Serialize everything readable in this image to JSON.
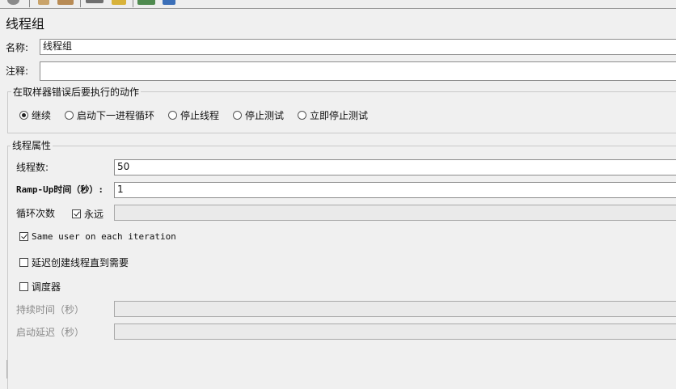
{
  "panel_title": "线程组",
  "name": {
    "label": "名称:",
    "value": "线程组"
  },
  "comment": {
    "label": "注释:",
    "value": ""
  },
  "error_action": {
    "title": "在取样器错误后要执行的动作",
    "options": [
      "继续",
      "启动下一进程循环",
      "停止线程",
      "停止测试",
      "立即停止测试"
    ],
    "selected": "继续"
  },
  "thread_props": {
    "title": "线程属性",
    "num_threads": {
      "label": "线程数:",
      "value": "50"
    },
    "ramp_up": {
      "label": "Ramp-Up时间（秒）:",
      "value": "1"
    },
    "loop": {
      "label": "循环次数",
      "forever_label": "永远",
      "forever_checked": true,
      "value": ""
    },
    "same_user": {
      "label": "Same user on each iteration",
      "checked": true
    },
    "delay_create": {
      "label": "延迟创建线程直到需要",
      "checked": false
    },
    "scheduler": {
      "label": "调度器",
      "checked": false
    },
    "duration": {
      "label": "持续时间（秒）",
      "value": ""
    },
    "startup_delay": {
      "label": "启动延迟（秒）",
      "value": ""
    }
  },
  "icons": [
    "toolbar-icon-1",
    "toolbar-icon-2",
    "toolbar-icon-3",
    "toolbar-icon-4",
    "toolbar-icon-5",
    "toolbar-icon-6",
    "toolbar-icon-7"
  ]
}
